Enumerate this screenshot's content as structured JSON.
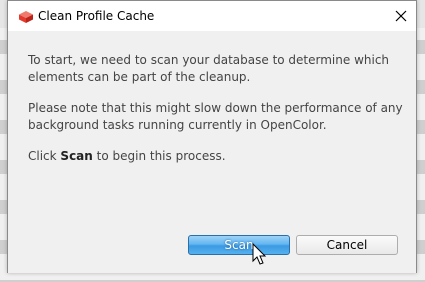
{
  "dialog": {
    "title": "Clean Profile Cache",
    "icon": "opencolor-app-icon",
    "close_icon": "close-icon",
    "message": {
      "p1": "To start, we need to scan your database to determine which elements can be part of the cleanup.",
      "p2": "Please note that this might slow down the performance of any background tasks running currently in OpenColor.",
      "p3_prefix": "Click ",
      "p3_bold": "Scan",
      "p3_suffix": " to begin this process."
    },
    "buttons": {
      "scan_label": "Scan",
      "cancel_label": "Cancel"
    }
  },
  "colors": {
    "accent": "#3c9ae2",
    "icon_red": "#e23b2e"
  }
}
